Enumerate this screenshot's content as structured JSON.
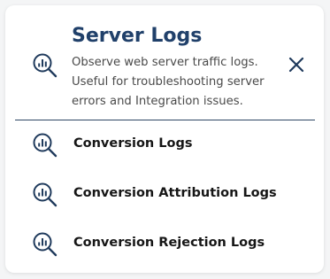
{
  "header": {
    "title": "Server Logs",
    "description": "Observe web server traffic logs. Useful for troubleshooting server errors and Integration issues.",
    "icon": "log-search-icon",
    "close_icon": "close-icon"
  },
  "items": [
    {
      "label": "Conversion Logs",
      "icon": "log-search-icon"
    },
    {
      "label": "Conversion Attribution Logs",
      "icon": "log-search-icon"
    },
    {
      "label": "Conversion Rejection Logs",
      "icon": "log-search-icon"
    }
  ],
  "colors": {
    "title": "#20406a",
    "icon": "#1f3a5c",
    "divider": "#2c4562"
  }
}
